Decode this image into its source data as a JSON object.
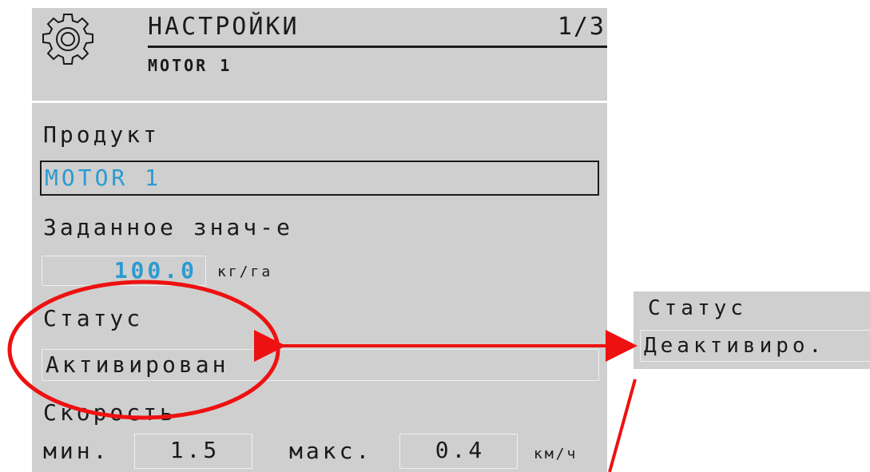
{
  "header": {
    "title": "НАСТРОЙКИ",
    "page": "1/3",
    "subtitle": "MOTOR 1",
    "icon": "gear-icon"
  },
  "product": {
    "label": "Продукт",
    "value": "MOTOR 1"
  },
  "target": {
    "label": "Заданное знач-е",
    "value": "100.0",
    "unit": "кг/га"
  },
  "status": {
    "label": "Статус",
    "value": "Активирован"
  },
  "speed": {
    "label": "Скорость",
    "min_label": "мин.",
    "min_value": "1.5",
    "max_label": "макс.",
    "max_value": "0.4",
    "unit": "км/ч"
  },
  "alt_status": {
    "label": "Статус",
    "value": "Деактивиро."
  },
  "colors": {
    "panel": "#cfcfcf",
    "value_text": "#2a9bd0",
    "annotation": "#ee1111"
  }
}
